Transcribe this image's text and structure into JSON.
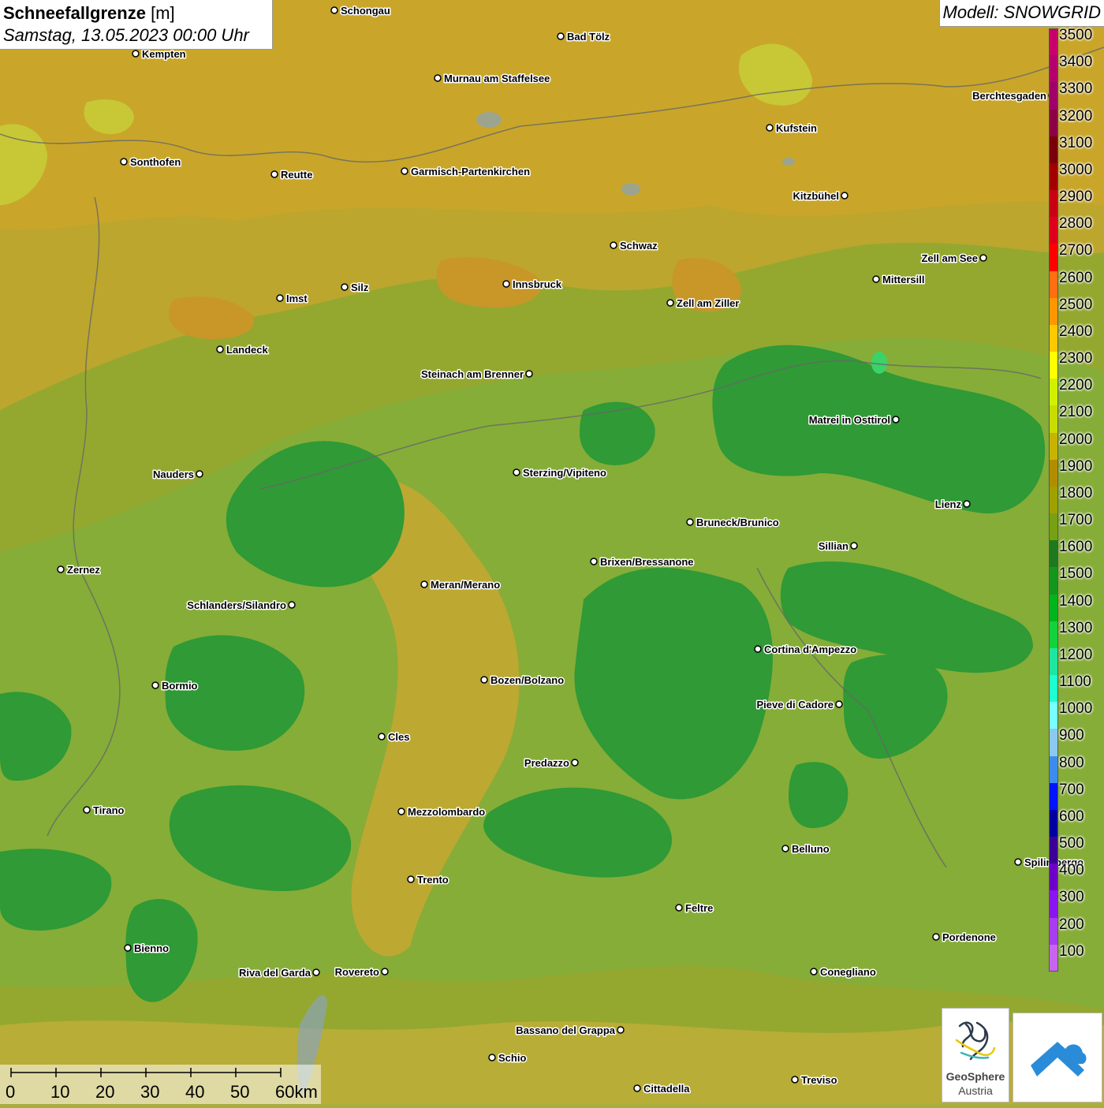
{
  "title": {
    "variable": "Schneefallgrenze",
    "unit": "[m]",
    "datetime": "Samstag, 13.05.2023 00:00 Uhr"
  },
  "model": "Modell: SNOWGRID",
  "legend": {
    "entries": [
      {
        "label": "3500",
        "color": "#c8006e"
      },
      {
        "label": "3400",
        "color": "#b4006e"
      },
      {
        "label": "3300",
        "color": "#a0006a"
      },
      {
        "label": "3200",
        "color": "#8c0046"
      },
      {
        "label": "3100",
        "color": "#78000a"
      },
      {
        "label": "3000",
        "color": "#a00000"
      },
      {
        "label": "2900",
        "color": "#c80014"
      },
      {
        "label": "2800",
        "color": "#dc001e"
      },
      {
        "label": "2700",
        "color": "#ff0000"
      },
      {
        "label": "2600",
        "color": "#ff6e14"
      },
      {
        "label": "2500",
        "color": "#ff9600"
      },
      {
        "label": "2400",
        "color": "#ffc800"
      },
      {
        "label": "2300",
        "color": "#ffff00"
      },
      {
        "label": "2200",
        "color": "#d2f000"
      },
      {
        "label": "2100",
        "color": "#c8dc00"
      },
      {
        "label": "2000",
        "color": "#c8b400"
      },
      {
        "label": "1900",
        "color": "#b48c00"
      },
      {
        "label": "1800",
        "color": "#a0a000"
      },
      {
        "label": "1700",
        "color": "#78a014"
      },
      {
        "label": "1600",
        "color": "#1e781e"
      },
      {
        "label": "1500",
        "color": "#14961e"
      },
      {
        "label": "1400",
        "color": "#00b41e"
      },
      {
        "label": "1300",
        "color": "#14d23c"
      },
      {
        "label": "1200",
        "color": "#1ee6a0"
      },
      {
        "label": "1100",
        "color": "#1effd2"
      },
      {
        "label": "1000",
        "color": "#78ffff"
      },
      {
        "label": "900",
        "color": "#8cc8f0"
      },
      {
        "label": "800",
        "color": "#3c8cf0"
      },
      {
        "label": "700",
        "color": "#0014ff"
      },
      {
        "label": "600",
        "color": "#0000a0"
      },
      {
        "label": "500",
        "color": "#3c0096"
      },
      {
        "label": "400",
        "color": "#6e00c8"
      },
      {
        "label": "300",
        "color": "#8c14f0"
      },
      {
        "label": "200",
        "color": "#aa3cf0"
      },
      {
        "label": "100",
        "color": "#c864f0"
      }
    ]
  },
  "cities": [
    {
      "name": "Schongau",
      "label_side": "right"
    },
    {
      "name": "Bad Tölz",
      "label_side": "right"
    },
    {
      "name": "Kempten",
      "label_side": "right"
    },
    {
      "name": "Murnau am Staffelsee",
      "label_side": "right"
    },
    {
      "name": "Berchtesgaden",
      "label_side": "left"
    },
    {
      "name": "Kufstein",
      "label_side": "right"
    },
    {
      "name": "Sonthofen",
      "label_side": "right"
    },
    {
      "name": "Reutte",
      "label_side": "right"
    },
    {
      "name": "Garmisch-Partenkirchen",
      "label_side": "right"
    },
    {
      "name": "Kitzbühel",
      "label_side": "left"
    },
    {
      "name": "Schwaz",
      "label_side": "right"
    },
    {
      "name": "Zell am See",
      "label_side": "left"
    },
    {
      "name": "Mittersill",
      "label_side": "right"
    },
    {
      "name": "Innsbruck",
      "label_side": "right"
    },
    {
      "name": "Imst",
      "label_side": "right"
    },
    {
      "name": "Silz",
      "label_side": "right"
    },
    {
      "name": "Zell am Ziller",
      "label_side": "right"
    },
    {
      "name": "Landeck",
      "label_side": "right"
    },
    {
      "name": "Steinach am Brenner",
      "label_side": "left"
    },
    {
      "name": "Matrei in Osttirol",
      "label_side": "left"
    },
    {
      "name": "Nauders",
      "label_side": "left"
    },
    {
      "name": "Sterzing/Vipiteno",
      "label_side": "right"
    },
    {
      "name": "Lienz",
      "label_side": "left"
    },
    {
      "name": "Bruneck/Brunico",
      "label_side": "right"
    },
    {
      "name": "Sillian",
      "label_side": "left"
    },
    {
      "name": "Zernez",
      "label_side": "right"
    },
    {
      "name": "Brixen/Bressanone",
      "label_side": "right"
    },
    {
      "name": "Meran/Merano",
      "label_side": "right"
    },
    {
      "name": "Schlanders/Silandro",
      "label_side": "left"
    },
    {
      "name": "Cortina d'Ampezzo",
      "label_side": "right"
    },
    {
      "name": "Bozen/Bolzano",
      "label_side": "right"
    },
    {
      "name": "Bormio",
      "label_side": "right"
    },
    {
      "name": "Pieve di Cadore",
      "label_side": "left"
    },
    {
      "name": "Cles",
      "label_side": "right"
    },
    {
      "name": "Predazzo",
      "label_side": "left"
    },
    {
      "name": "Tirano",
      "label_side": "right"
    },
    {
      "name": "Mezzolombardo",
      "label_side": "right"
    },
    {
      "name": "Belluno",
      "label_side": "right"
    },
    {
      "name": "Spilimbergo",
      "label_side": "right"
    },
    {
      "name": "Trento",
      "label_side": "right"
    },
    {
      "name": "Feltre",
      "label_side": "right"
    },
    {
      "name": "Pordenone",
      "label_side": "right"
    },
    {
      "name": "Bienno",
      "label_side": "right"
    },
    {
      "name": "Riva del Garda",
      "label_side": "left"
    },
    {
      "name": "Rovereto",
      "label_side": "left"
    },
    {
      "name": "Conegliano",
      "label_side": "right"
    },
    {
      "name": "Bassano del Grappa",
      "label_side": "left"
    },
    {
      "name": "Schio",
      "label_side": "right"
    },
    {
      "name": "Treviso",
      "label_side": "right"
    },
    {
      "name": "Cittadella",
      "label_side": "right"
    }
  ],
  "scale": {
    "labels": [
      "0",
      "10",
      "20",
      "30",
      "40",
      "50",
      "60km"
    ]
  },
  "logos": {
    "geosphere_line1": "GeoSphere",
    "geosphere_line2": "Austria"
  }
}
